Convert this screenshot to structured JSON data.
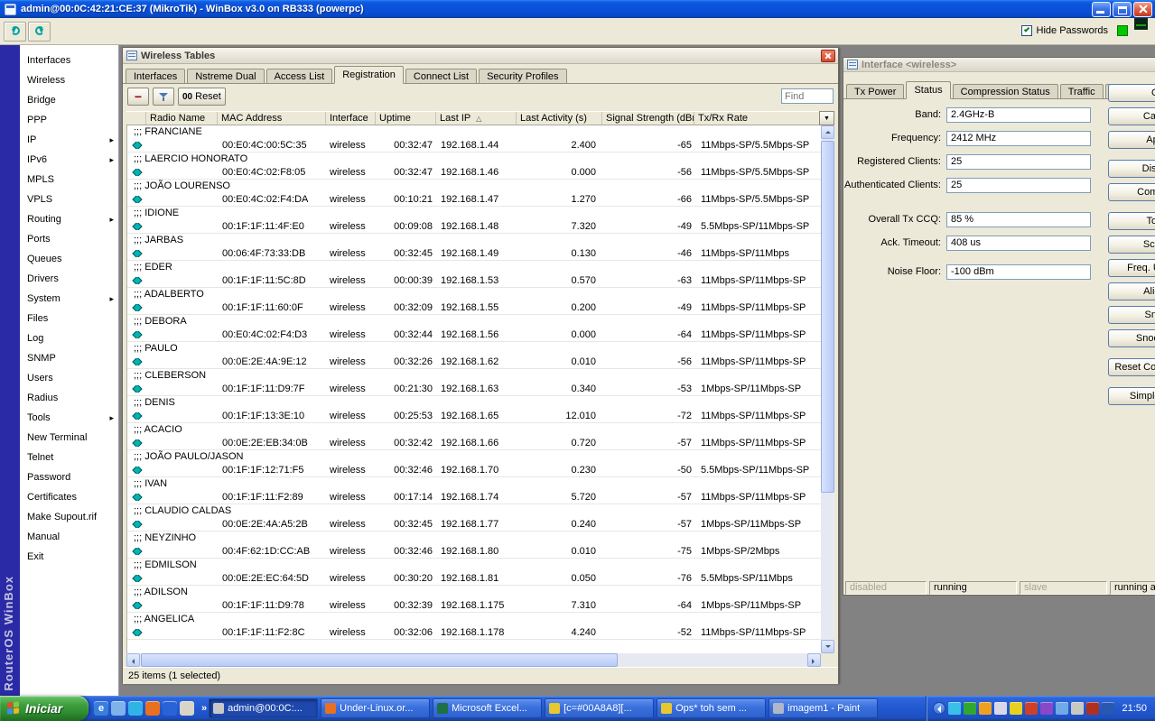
{
  "colors": {
    "titlebar_blue": "#0A4ED6",
    "taskbar_blue": "#2258D0",
    "start_green": "#3FA03F",
    "nav_strip_navy": "#2A2AA6",
    "window_face": "#ECE9D8",
    "close_red": "#D84830",
    "row_icon_teal": "#00B4B4",
    "indicator_green": "#00C800"
  },
  "titlebar": {
    "title": "admin@00:0C:42:21:CE:37 (MikroTik) - WinBox v3.0 on RB333 (powerpc)"
  },
  "app_toolbar": {
    "hide_passwords_label": "Hide Passwords"
  },
  "sidebar": {
    "brand_vertical": "RouterOS WinBox",
    "arrow_icon": "▸",
    "items": [
      {
        "label": "Interfaces"
      },
      {
        "label": "Wireless"
      },
      {
        "label": "Bridge"
      },
      {
        "label": "PPP"
      },
      {
        "label": "IP",
        "arrow": true
      },
      {
        "label": "IPv6",
        "arrow": true
      },
      {
        "label": "MPLS"
      },
      {
        "label": "VPLS"
      },
      {
        "label": "Routing",
        "arrow": true
      },
      {
        "label": "Ports"
      },
      {
        "label": "Queues"
      },
      {
        "label": "Drivers"
      },
      {
        "label": "System",
        "arrow": true
      },
      {
        "label": "Files"
      },
      {
        "label": "Log"
      },
      {
        "label": "SNMP"
      },
      {
        "label": "Users"
      },
      {
        "label": "Radius"
      },
      {
        "label": "Tools",
        "arrow": true
      },
      {
        "label": "New Terminal"
      },
      {
        "label": "Telnet"
      },
      {
        "label": "Password"
      },
      {
        "label": "Certificates"
      },
      {
        "label": "Make Supout.rif"
      },
      {
        "label": "Manual"
      },
      {
        "label": "Exit"
      }
    ]
  },
  "wireless_tables": {
    "title": "Wireless Tables",
    "tabs": [
      {
        "label": "Interfaces"
      },
      {
        "label": "Nstreme Dual"
      },
      {
        "label": "Access List"
      },
      {
        "label": "Registration",
        "active": true
      },
      {
        "label": "Connect List"
      },
      {
        "label": "Security Profiles"
      }
    ],
    "toolbar": {
      "remove_icon": "−",
      "reset_icon": "00",
      "reset_label": "Reset",
      "find_placeholder": "Find"
    },
    "columns": {
      "radio_name": "Radio Name",
      "mac": "MAC Address",
      "interface": "Interface",
      "uptime": "Uptime",
      "last_ip": "Last IP",
      "last_activity": "Last Activity (s)",
      "signal": "Signal Strength (dBm)",
      "rate": "Tx/Rx Rate"
    },
    "sort_icon": "△",
    "column_menu_icon": "▼",
    "comment_prefix": ";;; ",
    "rows": [
      {
        "name": "FRANCIANE",
        "mac": "00:E0:4C:00:5C:35",
        "iface": "wireless",
        "uptime": "00:32:47",
        "ip": "192.168.1.44",
        "act": "2.400",
        "sig": "-65",
        "rate": "11Mbps-SP/5.5Mbps-SP"
      },
      {
        "name": "LAERCIO HONORATO",
        "mac": "00:E0:4C:02:F8:05",
        "iface": "wireless",
        "uptime": "00:32:47",
        "ip": "192.168.1.46",
        "act": "0.000",
        "sig": "-56",
        "rate": "11Mbps-SP/5.5Mbps-SP"
      },
      {
        "name": "JOÃO LOURENSO",
        "mac": "00:E0:4C:02:F4:DA",
        "iface": "wireless",
        "uptime": "00:10:21",
        "ip": "192.168.1.47",
        "act": "1.270",
        "sig": "-66",
        "rate": "11Mbps-SP/5.5Mbps-SP"
      },
      {
        "name": "IDIONE",
        "mac": "00:1F:1F:11:4F:E0",
        "iface": "wireless",
        "uptime": "00:09:08",
        "ip": "192.168.1.48",
        "act": "7.320",
        "sig": "-49",
        "rate": "5.5Mbps-SP/11Mbps-SP"
      },
      {
        "name": "JARBAS",
        "mac": "00:06:4F:73:33:DB",
        "iface": "wireless",
        "uptime": "00:32:45",
        "ip": "192.168.1.49",
        "act": "0.130",
        "sig": "-46",
        "rate": "11Mbps-SP/11Mbps"
      },
      {
        "name": "EDER",
        "mac": "00:1F:1F:11:5C:8D",
        "iface": "wireless",
        "uptime": "00:00:39",
        "ip": "192.168.1.53",
        "act": "0.570",
        "sig": "-63",
        "rate": "11Mbps-SP/11Mbps-SP"
      },
      {
        "name": "ADALBERTO",
        "mac": "00:1F:1F:11:60:0F",
        "iface": "wireless",
        "uptime": "00:32:09",
        "ip": "192.168.1.55",
        "act": "0.200",
        "sig": "-49",
        "rate": "11Mbps-SP/11Mbps-SP"
      },
      {
        "name": "DEBORA",
        "mac": "00:E0:4C:02:F4:D3",
        "iface": "wireless",
        "uptime": "00:32:44",
        "ip": "192.168.1.56",
        "act": "0.000",
        "sig": "-64",
        "rate": "11Mbps-SP/11Mbps-SP"
      },
      {
        "name": "PAULO",
        "mac": "00:0E:2E:4A:9E:12",
        "iface": "wireless",
        "uptime": "00:32:26",
        "ip": "192.168.1.62",
        "act": "0.010",
        "sig": "-56",
        "rate": "11Mbps-SP/11Mbps-SP"
      },
      {
        "name": "CLEBERSON",
        "mac": "00:1F:1F:11:D9:7F",
        "iface": "wireless",
        "uptime": "00:21:30",
        "ip": "192.168.1.63",
        "act": "0.340",
        "sig": "-53",
        "rate": "1Mbps-SP/11Mbps-SP"
      },
      {
        "name": "DENIS",
        "mac": "00:1F:1F:13:3E:10",
        "iface": "wireless",
        "uptime": "00:25:53",
        "ip": "192.168.1.65",
        "act": "12.010",
        "sig": "-72",
        "rate": "11Mbps-SP/11Mbps-SP"
      },
      {
        "name": "ACACIO",
        "mac": "00:0E:2E:EB:34:0B",
        "iface": "wireless",
        "uptime": "00:32:42",
        "ip": "192.168.1.66",
        "act": "0.720",
        "sig": "-57",
        "rate": "11Mbps-SP/11Mbps-SP"
      },
      {
        "name": "JOÃO PAULO/JASON",
        "mac": "00:1F:1F:12:71:F5",
        "iface": "wireless",
        "uptime": "00:32:46",
        "ip": "192.168.1.70",
        "act": "0.230",
        "sig": "-50",
        "rate": "5.5Mbps-SP/11Mbps-SP"
      },
      {
        "name": "IVAN",
        "mac": "00:1F:1F:11:F2:89",
        "iface": "wireless",
        "uptime": "00:17:14",
        "ip": "192.168.1.74",
        "act": "5.720",
        "sig": "-57",
        "rate": "11Mbps-SP/11Mbps-SP"
      },
      {
        "name": "CLAUDIO CALDAS",
        "mac": "00:0E:2E:4A:A5:2B",
        "iface": "wireless",
        "uptime": "00:32:45",
        "ip": "192.168.1.77",
        "act": "0.240",
        "sig": "-57",
        "rate": "1Mbps-SP/11Mbps-SP"
      },
      {
        "name": "NEYZINHO",
        "mac": "00:4F:62:1D:CC:AB",
        "iface": "wireless",
        "uptime": "00:32:46",
        "ip": "192.168.1.80",
        "act": "0.010",
        "sig": "-75",
        "rate": "1Mbps-SP/2Mbps"
      },
      {
        "name": "EDMILSON",
        "mac": "00:0E:2E:EC:64:5D",
        "iface": "wireless",
        "uptime": "00:30:20",
        "ip": "192.168.1.81",
        "act": "0.050",
        "sig": "-76",
        "rate": "5.5Mbps-SP/11Mbps"
      },
      {
        "name": "ADILSON",
        "mac": "00:1F:1F:11:D9:78",
        "iface": "wireless",
        "uptime": "00:32:39",
        "ip": "192.168.1.175",
        "act": "7.310",
        "sig": "-64",
        "rate": "1Mbps-SP/11Mbps-SP"
      },
      {
        "name": "ANGELICA",
        "mac": "00:1F:1F:11:F2:8C",
        "iface": "wireless",
        "uptime": "00:32:06",
        "ip": "192.168.1.178",
        "act": "4.240",
        "sig": "-52",
        "rate": "11Mbps-SP/11Mbps-SP"
      }
    ],
    "status_text": "25 items (1 selected)"
  },
  "interface_window": {
    "title": "Interface <wireless>",
    "tabs": [
      {
        "label": "Tx Power"
      },
      {
        "label": "Status",
        "active": true
      },
      {
        "label": "Compression Status"
      },
      {
        "label": "Traffic"
      },
      {
        "label": "..."
      }
    ],
    "fields": [
      {
        "label": "Band:",
        "value": "2.4GHz-B"
      },
      {
        "label": "Frequency:",
        "value": "2412 MHz"
      },
      {
        "label": "Registered Clients:",
        "value": "25"
      },
      {
        "label": "Authenticated Clients:",
        "value": "25"
      },
      {
        "label": "Overall Tx CCQ:",
        "value": "85 %"
      },
      {
        "label": "Ack. Timeout:",
        "value": "408 us"
      },
      {
        "label": "Noise Floor:",
        "value": "-100 dBm"
      }
    ],
    "buttons": [
      {
        "label": "OK"
      },
      {
        "label": "Cancel"
      },
      {
        "label": "Apply"
      },
      {
        "label": "Disable"
      },
      {
        "label": "Comment"
      },
      {
        "label": "Torch"
      },
      {
        "label": "Scan..."
      },
      {
        "label": "Freq. Usage..."
      },
      {
        "label": "Align..."
      },
      {
        "label": "Sniff..."
      },
      {
        "label": "Snooper..."
      },
      {
        "label": "Reset Configuration"
      },
      {
        "label": "Simple Mode"
      }
    ],
    "status_flags": [
      {
        "label": "disabled",
        "muted": true
      },
      {
        "label": "running"
      },
      {
        "label": "slave",
        "muted": true
      },
      {
        "label": "running ap"
      }
    ]
  },
  "taskbar": {
    "start_label": "Iniciar",
    "quick_launch": [
      {
        "icon": "internet-explorer-icon",
        "color": "#3A7EDC",
        "glyph": "e"
      },
      {
        "icon": "outlook-express-icon",
        "color": "#7EB2E8",
        "glyph": ""
      },
      {
        "icon": "msn-messenger-icon",
        "color": "#30B4E8",
        "glyph": ""
      },
      {
        "icon": "firefox-icon",
        "color": "#E87020",
        "glyph": ""
      },
      {
        "icon": "media-player-icon",
        "color": "#2A62D8",
        "glyph": ""
      },
      {
        "icon": "show-desktop-icon",
        "color": "#D8D4C8",
        "glyph": ""
      }
    ],
    "chevron_icon": "»",
    "tasks": [
      {
        "label": "admin@00:0C:...",
        "icon": "winbox-icon",
        "color": "#C8C8C8",
        "active": true
      },
      {
        "label": "Under-Linux.or...",
        "icon": "firefox-icon",
        "color": "#E87020"
      },
      {
        "label": "Microsoft Excel...",
        "icon": "excel-icon",
        "color": "#1E7145"
      },
      {
        "label": "[c=#00A8A8][...",
        "icon": "mirc-icon",
        "color": "#E8C830"
      },
      {
        "label": "Ops* toh sem ...",
        "icon": "mirc-icon",
        "color": "#E8C830"
      },
      {
        "label": "imagem1 - Paint",
        "icon": "paint-icon",
        "color": "#B0B8C8"
      }
    ],
    "tray_icons": [
      {
        "icon": "network-icon",
        "color": "#3AC0E8"
      },
      {
        "icon": "antivirus-icon",
        "color": "#30A830"
      },
      {
        "icon": "messenger-icon",
        "color": "#F0A020"
      },
      {
        "icon": "volume-icon",
        "color": "#D8D8E8"
      },
      {
        "icon": "update-icon",
        "color": "#E8D020"
      },
      {
        "icon": "firewall-icon",
        "color": "#D04028"
      },
      {
        "icon": "graphics-icon",
        "color": "#8848C8"
      },
      {
        "icon": "usb-icon",
        "color": "#70A8E8"
      },
      {
        "icon": "printer-icon",
        "color": "#C8C8C0"
      },
      {
        "icon": "language-icon",
        "color": "#B03020"
      },
      {
        "icon": "scheduler-icon",
        "color": "#2858B0"
      }
    ],
    "clock": "21:50"
  }
}
